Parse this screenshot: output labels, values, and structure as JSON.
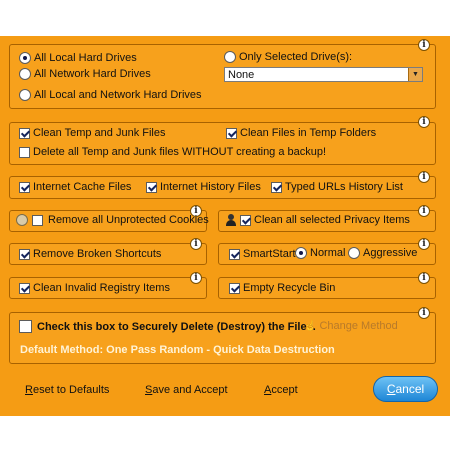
{
  "drives": {
    "all_local": "All Local Hard Drives",
    "all_network": "All Network Hard Drives",
    "all_local_network": "All Local and Network Hard Drives",
    "only_selected": "Only Selected Drive(s):",
    "selected_value": "None"
  },
  "temp": {
    "clean_temp_junk": "Clean Temp and Junk Files",
    "clean_temp_folders": "Clean Files in Temp Folders",
    "delete_without_backup": "Delete all Temp and Junk files WITHOUT creating a backup!"
  },
  "internet": {
    "cache": "Internet Cache Files",
    "history": "Internet History Files",
    "typed_urls": "Typed URLs History List"
  },
  "cookies": {
    "label": "Remove all Unprotected Cookies"
  },
  "privacy": {
    "label": "Clean all selected Privacy Items"
  },
  "shortcuts": {
    "label": "Remove Broken Shortcuts"
  },
  "smartstart": {
    "label": "SmartStart:",
    "normal": "Normal",
    "aggressive": "Aggressive"
  },
  "registry": {
    "label": "Clean Invalid Registry Items"
  },
  "recycle": {
    "label": "Empty Recycle Bin"
  },
  "secure": {
    "label": "Check this box to Securely Delete (Destroy) the Files.",
    "change_method": "Change Method",
    "default_method": "Default Method:  One Pass Random - Quick Data Destruction"
  },
  "footer": {
    "reset_first": "R",
    "reset_rest": "eset to Defaults",
    "save_first": "S",
    "save_rest": "ave and Accept",
    "accept_first": "A",
    "accept_rest": "ccept",
    "cancel_first": "C",
    "cancel_rest": "ancel"
  },
  "info_glyph": "i"
}
